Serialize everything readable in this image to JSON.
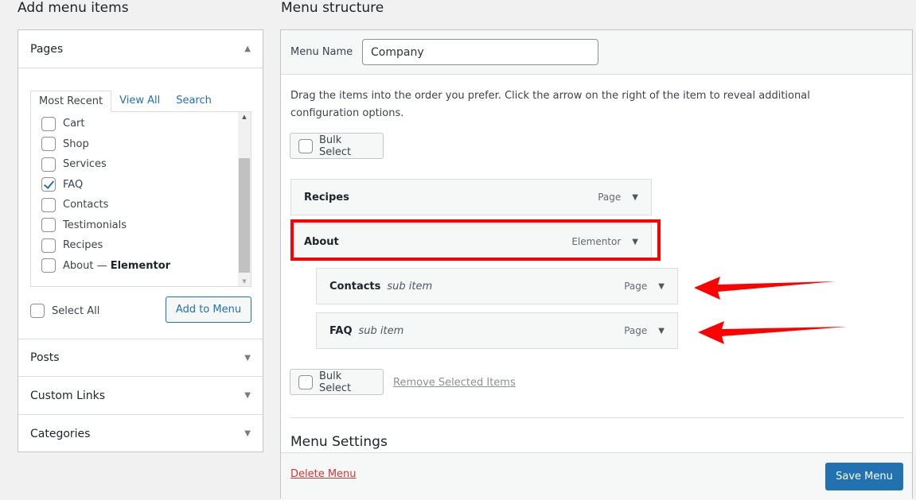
{
  "left": {
    "title": "Add menu items",
    "pages": {
      "title": "Pages",
      "tabs": [
        "Most Recent",
        "View All",
        "Search"
      ],
      "items": [
        {
          "label": "Cart",
          "checked": false
        },
        {
          "label": "Shop",
          "checked": false
        },
        {
          "label": "Services",
          "checked": false
        },
        {
          "label": "FAQ",
          "checked": true
        },
        {
          "label": "Contacts",
          "checked": false
        },
        {
          "label": "Testimonials",
          "checked": false
        },
        {
          "label": "Recipes",
          "checked": false
        },
        {
          "label": "About — ",
          "bold": "Elementor",
          "checked": false
        }
      ],
      "select_all": "Select All",
      "add_button": "Add to Menu"
    },
    "sections": [
      "Posts",
      "Custom Links",
      "Categories"
    ]
  },
  "right": {
    "title": "Menu structure",
    "menu_name_label": "Menu Name",
    "menu_name_value": "Company",
    "instructions": "Drag the items into the order you prefer. Click the arrow on the right of the item to reveal additional configuration options.",
    "bulk_select": "Bulk Select",
    "items": [
      {
        "title": "Recipes",
        "sub": "",
        "type": "Page"
      },
      {
        "title": "About",
        "sub": "",
        "type": "Elementor"
      },
      {
        "title": "Contacts",
        "sub": "sub item",
        "type": "Page"
      },
      {
        "title": "FAQ",
        "sub": "sub item",
        "type": "Page"
      }
    ],
    "remove_selected": "Remove Selected Items",
    "settings_title": "Menu Settings",
    "delete_menu": "Delete Menu",
    "save_menu": "Save Menu"
  },
  "colors": {
    "highlight": "#ff0000",
    "accent": "#2271b1",
    "delete": "#d63638"
  }
}
